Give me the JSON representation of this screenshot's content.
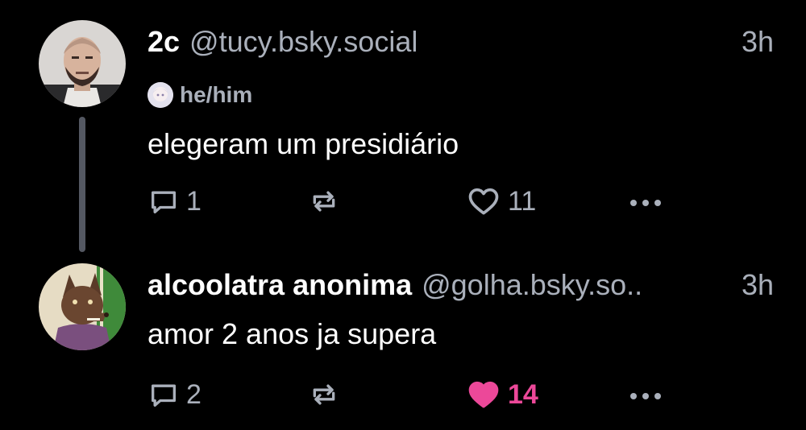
{
  "colors": {
    "background": "#000000",
    "text_primary": "#ffffff",
    "text_secondary": "#aab0bb",
    "thread_line": "#545862",
    "like_active": "#ec4899"
  },
  "posts": [
    {
      "display_name": "2c",
      "handle": "@tucy.bsky.social",
      "time": "3h",
      "pronouns": "he/him",
      "text": "elegeram um presidiário",
      "actions": {
        "reply_icon": "reply-icon",
        "reply_count": "1",
        "repost_icon": "repost-icon",
        "repost_count": "",
        "like_icon": "heart-outline-icon",
        "like_count": "11",
        "liked": false,
        "more_icon": "more-icon"
      }
    },
    {
      "display_name": "alcoolatra anonima",
      "handle": "@golha.bsky.so..",
      "time": "3h",
      "text": "amor 2 anos ja supera",
      "actions": {
        "reply_icon": "reply-icon",
        "reply_count": "2",
        "repost_icon": "repost-icon",
        "repost_count": "",
        "like_icon": "heart-filled-icon",
        "like_count": "14",
        "liked": true,
        "more_icon": "more-icon"
      }
    }
  ]
}
